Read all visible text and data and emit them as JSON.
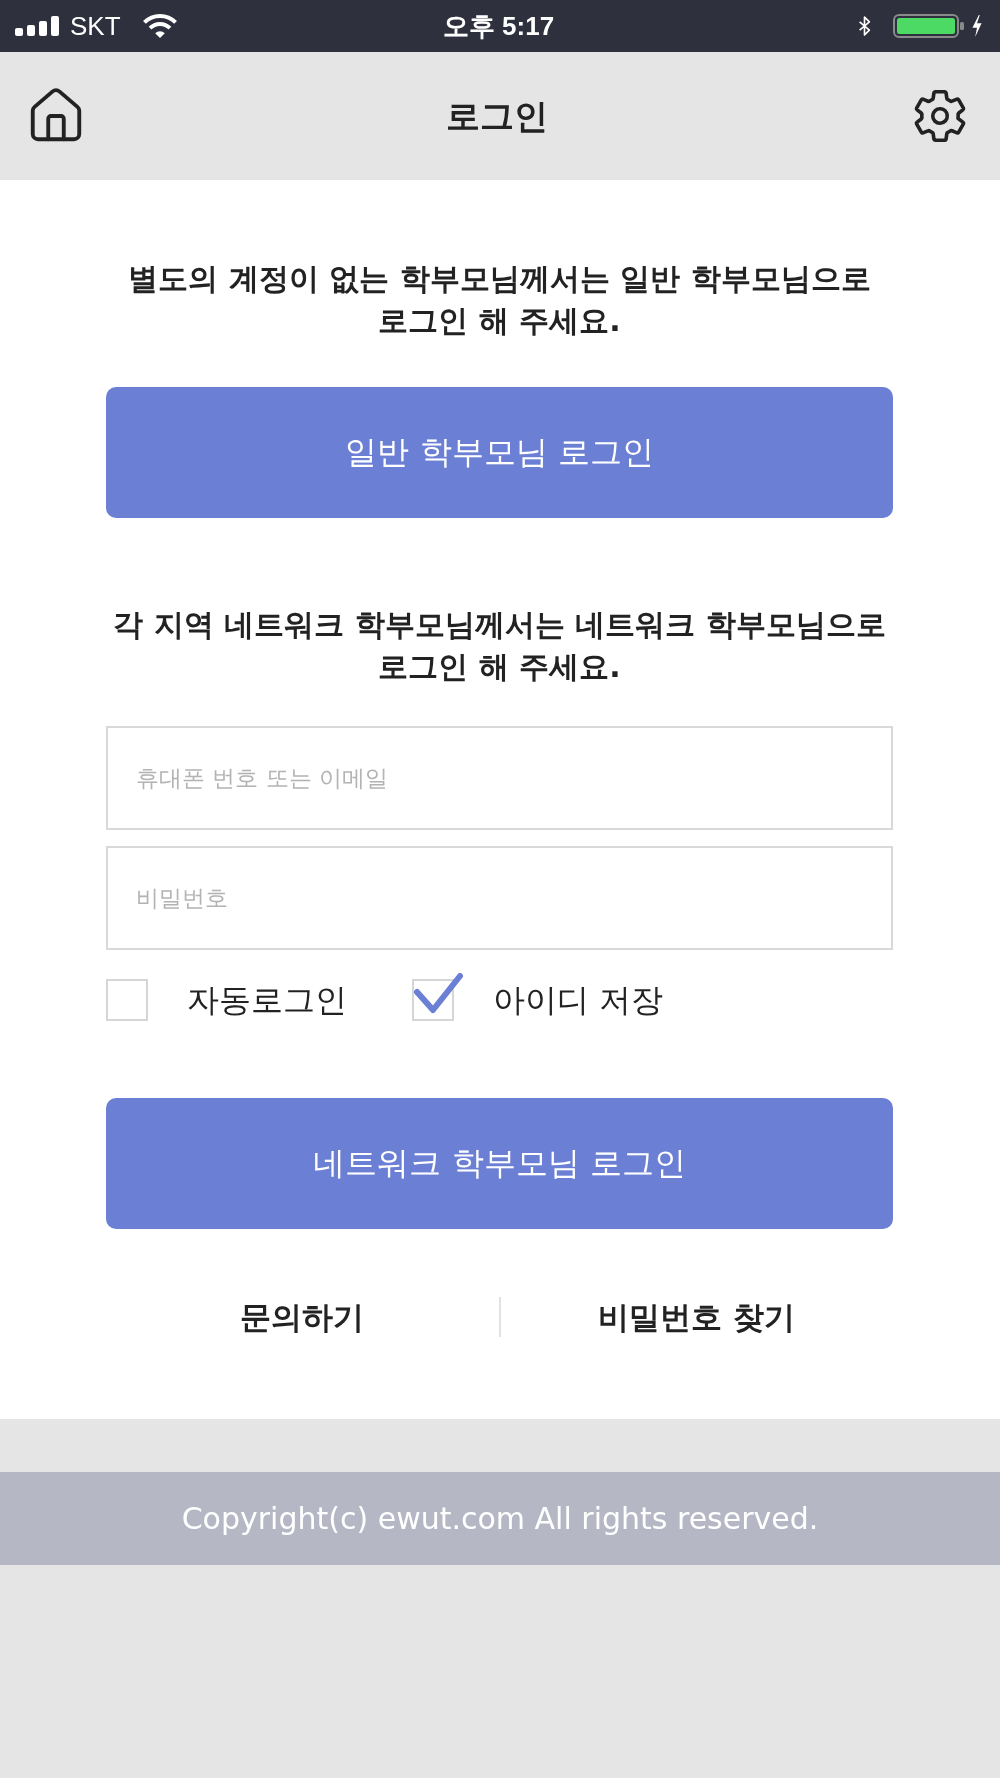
{
  "status_bar": {
    "carrier": "SKT",
    "time": "오후 5:17"
  },
  "header": {
    "title": "로그인"
  },
  "general_section": {
    "notice": "별도의 계정이 없는 학부모님께서는 일반 학부모님으로 로그인 해 주세요.",
    "button": "일반 학부모님 로그인"
  },
  "network_section": {
    "notice": "각 지역 네트워크 학부모님께서는 네트워크 학부모님으로 로그인 해 주세요.",
    "phone_field": {
      "placeholder": "휴대폰 번호 또는 이메일"
    },
    "password_field": {
      "placeholder": "비밀번호"
    },
    "options": [
      {
        "label": "자동로그인",
        "checked": false
      },
      {
        "label": "아이디 저장",
        "checked": true
      }
    ],
    "button": "네트워크 학부모님 로그인"
  },
  "links": [
    "문의하기",
    "비밀번호 찾기"
  ],
  "footer": {
    "copyright": "Copyright(c) ewut.com All rights reserved."
  }
}
